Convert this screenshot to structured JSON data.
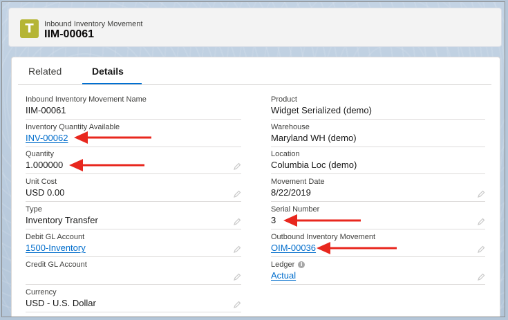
{
  "header": {
    "object_type": "Inbound Inventory Movement",
    "record_name": "IIM-00061",
    "icon": "inventory-movement-icon",
    "icon_glyph": "T",
    "icon_color": "#b5b535"
  },
  "tabs": [
    {
      "label": "Related",
      "active": false
    },
    {
      "label": "Details",
      "active": true
    }
  ],
  "fields_left": [
    {
      "label": "Inbound Inventory Movement Name",
      "value": "IIM-00061",
      "link": false,
      "editable": false
    },
    {
      "label": "Inventory Quantity Available",
      "value": "INV-00062",
      "link": true,
      "editable": false
    },
    {
      "label": "Quantity",
      "value": "1.000000",
      "link": false,
      "editable": true
    },
    {
      "label": "Unit Cost",
      "value": "USD 0.00",
      "link": false,
      "editable": true
    },
    {
      "label": "Type",
      "value": "Inventory Transfer",
      "link": false,
      "editable": true
    },
    {
      "label": "Debit GL Account",
      "value": "1500-Inventory",
      "link": true,
      "editable": true
    },
    {
      "label": "Credit GL Account",
      "value": "",
      "link": false,
      "editable": true
    },
    {
      "label": "Currency",
      "value": "USD - U.S. Dollar",
      "link": false,
      "editable": true
    }
  ],
  "fields_right": [
    {
      "label": "Product",
      "value": "Widget Serialized (demo)",
      "link": false,
      "editable": false
    },
    {
      "label": "Warehouse",
      "value": "Maryland WH (demo)",
      "link": false,
      "editable": false
    },
    {
      "label": "Location",
      "value": "Columbia Loc (demo)",
      "link": false,
      "editable": false
    },
    {
      "label": "Movement Date",
      "value": "8/22/2019",
      "link": false,
      "editable": true
    },
    {
      "label": "Serial Number",
      "value": "3",
      "link": false,
      "editable": true
    },
    {
      "label": "Outbound Inventory Movement",
      "value": "OIM-00036",
      "link": true,
      "editable": true
    },
    {
      "label": "Ledger",
      "value": "Actual",
      "link": true,
      "editable": true,
      "info_icon": true
    }
  ],
  "colors": {
    "link": "#006dcc",
    "active_tab_border": "#0070d2",
    "annotation_arrow": "#e8271e"
  }
}
